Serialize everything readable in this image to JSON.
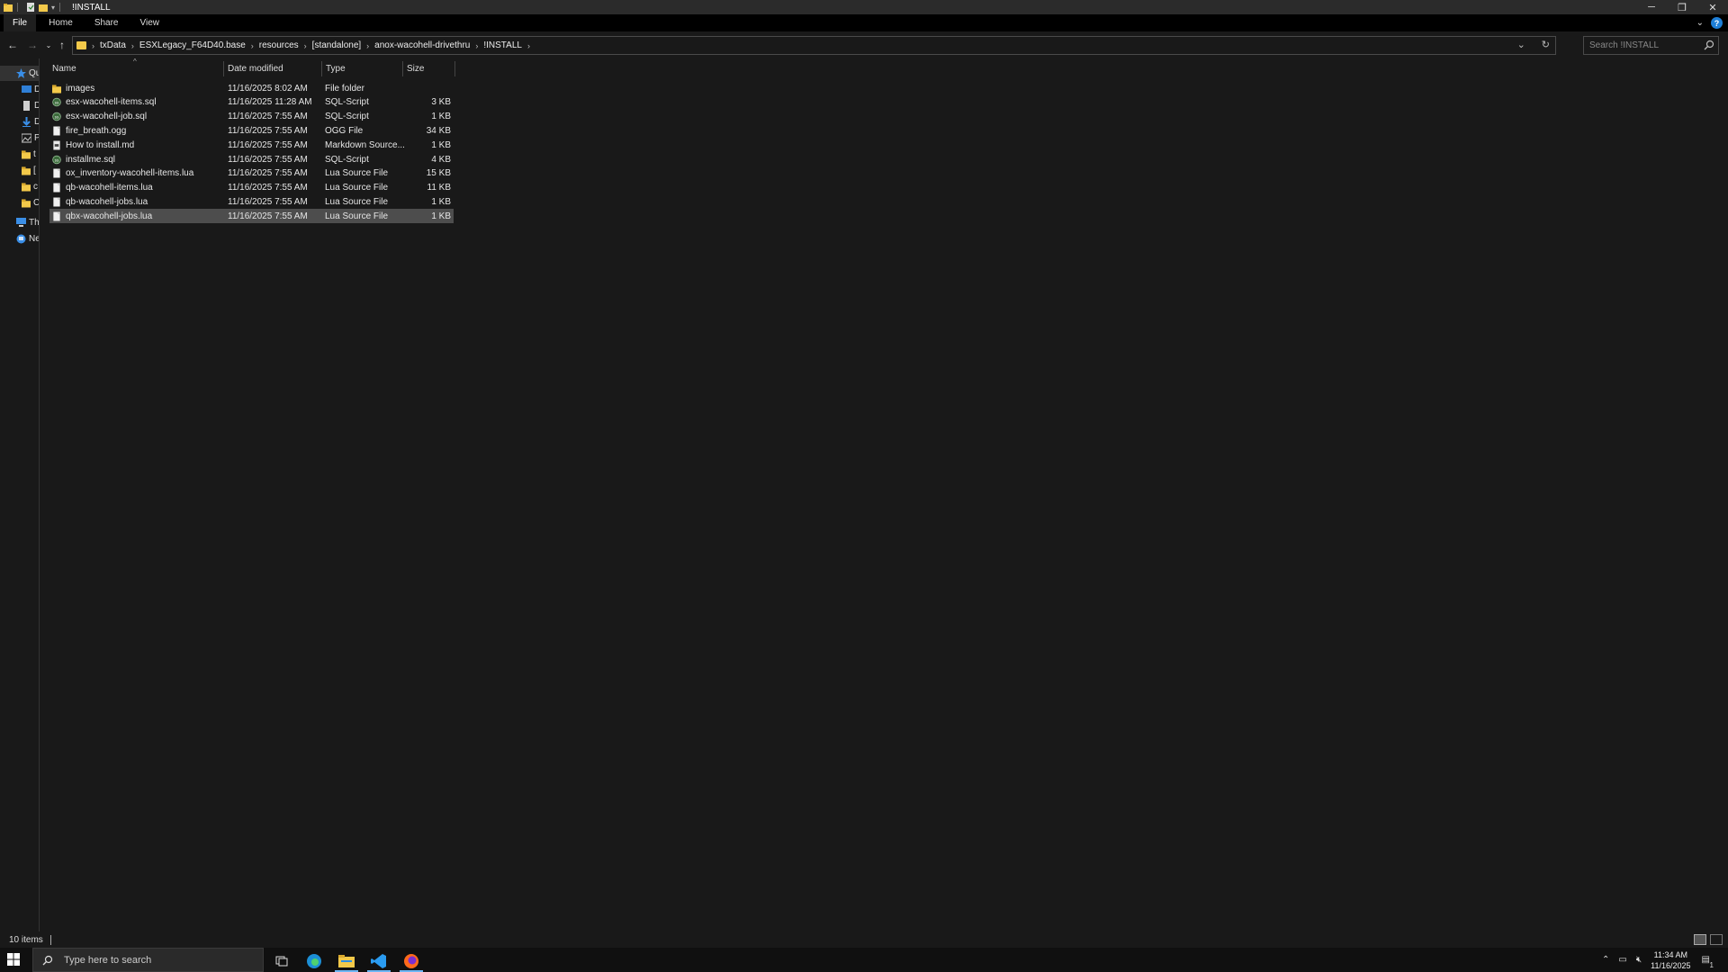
{
  "window": {
    "title": "!INSTALL",
    "minimize_icon": "minimize-icon",
    "restore_icon": "restore-icon",
    "close_icon": "close-icon"
  },
  "ribbon": {
    "tabs": [
      {
        "label": "File"
      },
      {
        "label": "Home"
      },
      {
        "label": "Share"
      },
      {
        "label": "View"
      }
    ],
    "help_label": "?"
  },
  "address": {
    "crumbs": [
      "txData",
      "ESXLegacy_F64D40.base",
      "resources",
      "[standalone]",
      "anox-wacohell-drivethru",
      "!INSTALL"
    ]
  },
  "search": {
    "placeholder": "Search !INSTALL"
  },
  "navpane": {
    "items": [
      {
        "label": "Qu",
        "icon": "star-icon",
        "color": "#3a8ee6"
      },
      {
        "label": "D",
        "icon": "desktop-icon",
        "color": "#2f7fd6"
      },
      {
        "label": "D",
        "icon": "document-icon",
        "color": "#cfcfcf"
      },
      {
        "label": "D",
        "icon": "download-icon",
        "color": "#3a8ee6"
      },
      {
        "label": "P",
        "icon": "pictures-icon",
        "color": "#cfcfcf"
      },
      {
        "label": "t",
        "icon": "folder-icon",
        "color": "#f3c94a"
      },
      {
        "label": "[",
        "icon": "folder-icon",
        "color": "#f3c94a"
      },
      {
        "label": "c",
        "icon": "folder-icon",
        "color": "#f3c94a"
      },
      {
        "label": "C",
        "icon": "folder-icon",
        "color": "#f3c94a"
      },
      {
        "label": "Th",
        "icon": "computer-icon",
        "color": "#3a8ee6"
      },
      {
        "label": "Ne",
        "icon": "network-icon",
        "color": "#3a8ee6"
      }
    ]
  },
  "columns": {
    "name": "Name",
    "date": "Date modified",
    "type": "Type",
    "size": "Size"
  },
  "files": [
    {
      "name": "images",
      "date": "11/16/2025 8:02 AM",
      "type": "File folder",
      "size": "",
      "icon": "folder-icon"
    },
    {
      "name": "esx-wacohell-items.sql",
      "date": "11/16/2025 11:28 AM",
      "type": "SQL-Script",
      "size": "3 KB",
      "icon": "sql-script-icon"
    },
    {
      "name": "esx-wacohell-job.sql",
      "date": "11/16/2025 7:55 AM",
      "type": "SQL-Script",
      "size": "1 KB",
      "icon": "sql-script-icon"
    },
    {
      "name": "fire_breath.ogg",
      "date": "11/16/2025 7:55 AM",
      "type": "OGG File",
      "size": "34 KB",
      "icon": "file-icon"
    },
    {
      "name": "How to install.md",
      "date": "11/16/2025 7:55 AM",
      "type": "Markdown Source...",
      "size": "1 KB",
      "icon": "markdown-file-icon"
    },
    {
      "name": "installme.sql",
      "date": "11/16/2025 7:55 AM",
      "type": "SQL-Script",
      "size": "4 KB",
      "icon": "sql-script-icon"
    },
    {
      "name": "ox_inventory-wacohell-items.lua",
      "date": "11/16/2025 7:55 AM",
      "type": "Lua Source File",
      "size": "15 KB",
      "icon": "file-icon"
    },
    {
      "name": "qb-wacohell-items.lua",
      "date": "11/16/2025 7:55 AM",
      "type": "Lua Source File",
      "size": "11 KB",
      "icon": "file-icon"
    },
    {
      "name": "qb-wacohell-jobs.lua",
      "date": "11/16/2025 7:55 AM",
      "type": "Lua Source File",
      "size": "1 KB",
      "icon": "file-icon"
    },
    {
      "name": "qbx-wacohell-jobs.lua",
      "date": "11/16/2025 7:55 AM",
      "type": "Lua Source File",
      "size": "1 KB",
      "icon": "file-icon",
      "selected": true
    }
  ],
  "status": {
    "item_count": "10 items"
  },
  "taskbar": {
    "search_placeholder": "Type here to search",
    "time": "11:34 AM",
    "date": "11/16/2025",
    "notification_count": "1"
  },
  "colors": {
    "folder": "#f3c94a",
    "accent": "#3a8ee6",
    "selection": "#4d4d4d"
  }
}
